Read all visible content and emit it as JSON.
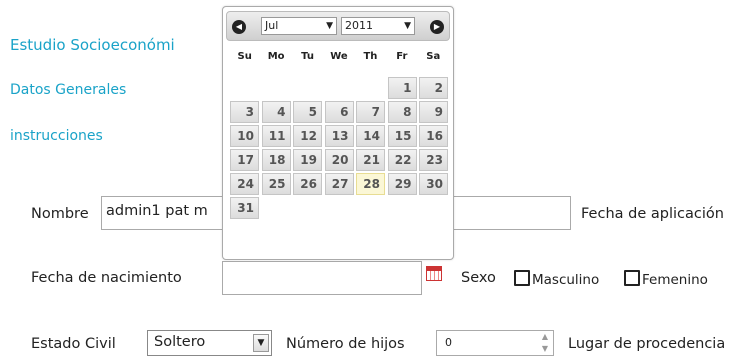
{
  "page": {
    "title": "Estudio Socioeconómi",
    "datos_generales": "Datos Generales",
    "instrucciones": "instrucciones"
  },
  "form": {
    "nombre_label": "Nombre",
    "nombre_value": "admin1 pat m",
    "fecha_aplicacion_label": "Fecha de aplicación",
    "fecha_nacimiento_label": "Fecha de nacimiento",
    "fecha_nacimiento_value": "",
    "sexo_label": "Sexo",
    "masculino_label": "Masculino",
    "femenino_label": "Femenino",
    "estado_civil_label": "Estado Civil",
    "estado_civil_value": "Soltero",
    "numero_hijos_label": "Número de hijos",
    "numero_hijos_value": "0",
    "lugar_procedencia_label": "Lugar de procedencia"
  },
  "datepicker": {
    "month": "Jul",
    "year": "2011",
    "weekdays": [
      "Su",
      "Mo",
      "Tu",
      "We",
      "Th",
      "Fr",
      "Sa"
    ],
    "leading_blanks": 5,
    "days": [
      "1",
      "2",
      "3",
      "4",
      "5",
      "6",
      "7",
      "8",
      "9",
      "10",
      "11",
      "12",
      "13",
      "14",
      "15",
      "16",
      "17",
      "18",
      "19",
      "20",
      "21",
      "22",
      "23",
      "24",
      "25",
      "26",
      "27",
      "28",
      "29",
      "30",
      "31"
    ],
    "highlighted_day": "28",
    "icons": {
      "prev": "circle-triangle-left-icon",
      "next": "circle-triangle-right-icon"
    }
  },
  "colors": {
    "link": "#1aa3c8",
    "today": "#fbf7d6",
    "calendar_icon": "#cc3333"
  }
}
